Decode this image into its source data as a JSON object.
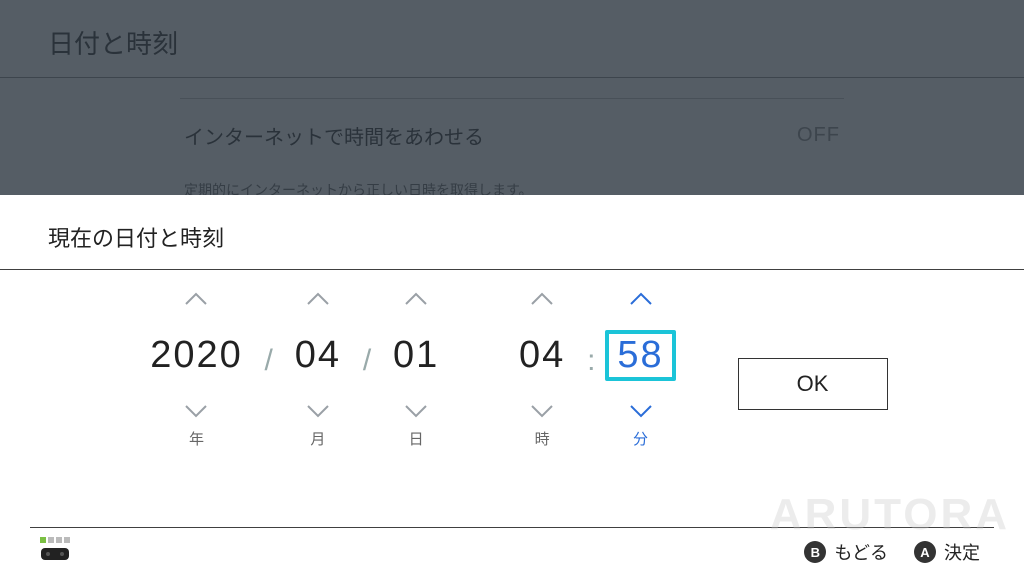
{
  "bg": {
    "title": "日付と時刻",
    "internet_sync_label": "インターネットで時間をあわせる",
    "internet_sync_value": "OFF",
    "help": "定期的にインターネットから正しい日時を取得します。"
  },
  "modal": {
    "title": "現在の日付と時刻",
    "columns": {
      "year": {
        "value": "2020",
        "label": "年"
      },
      "month": {
        "value": "04",
        "label": "月"
      },
      "day": {
        "value": "01",
        "label": "日"
      },
      "hour": {
        "value": "04",
        "label": "時"
      },
      "minute": {
        "value": "58",
        "label": "分"
      }
    },
    "separators": {
      "date": "/",
      "time": ":"
    },
    "ok_label": "OK"
  },
  "footer": {
    "back_key": "B",
    "back_label": "もどる",
    "ok_key": "A",
    "ok_label": "決定"
  },
  "watermark": "ARUTORA"
}
